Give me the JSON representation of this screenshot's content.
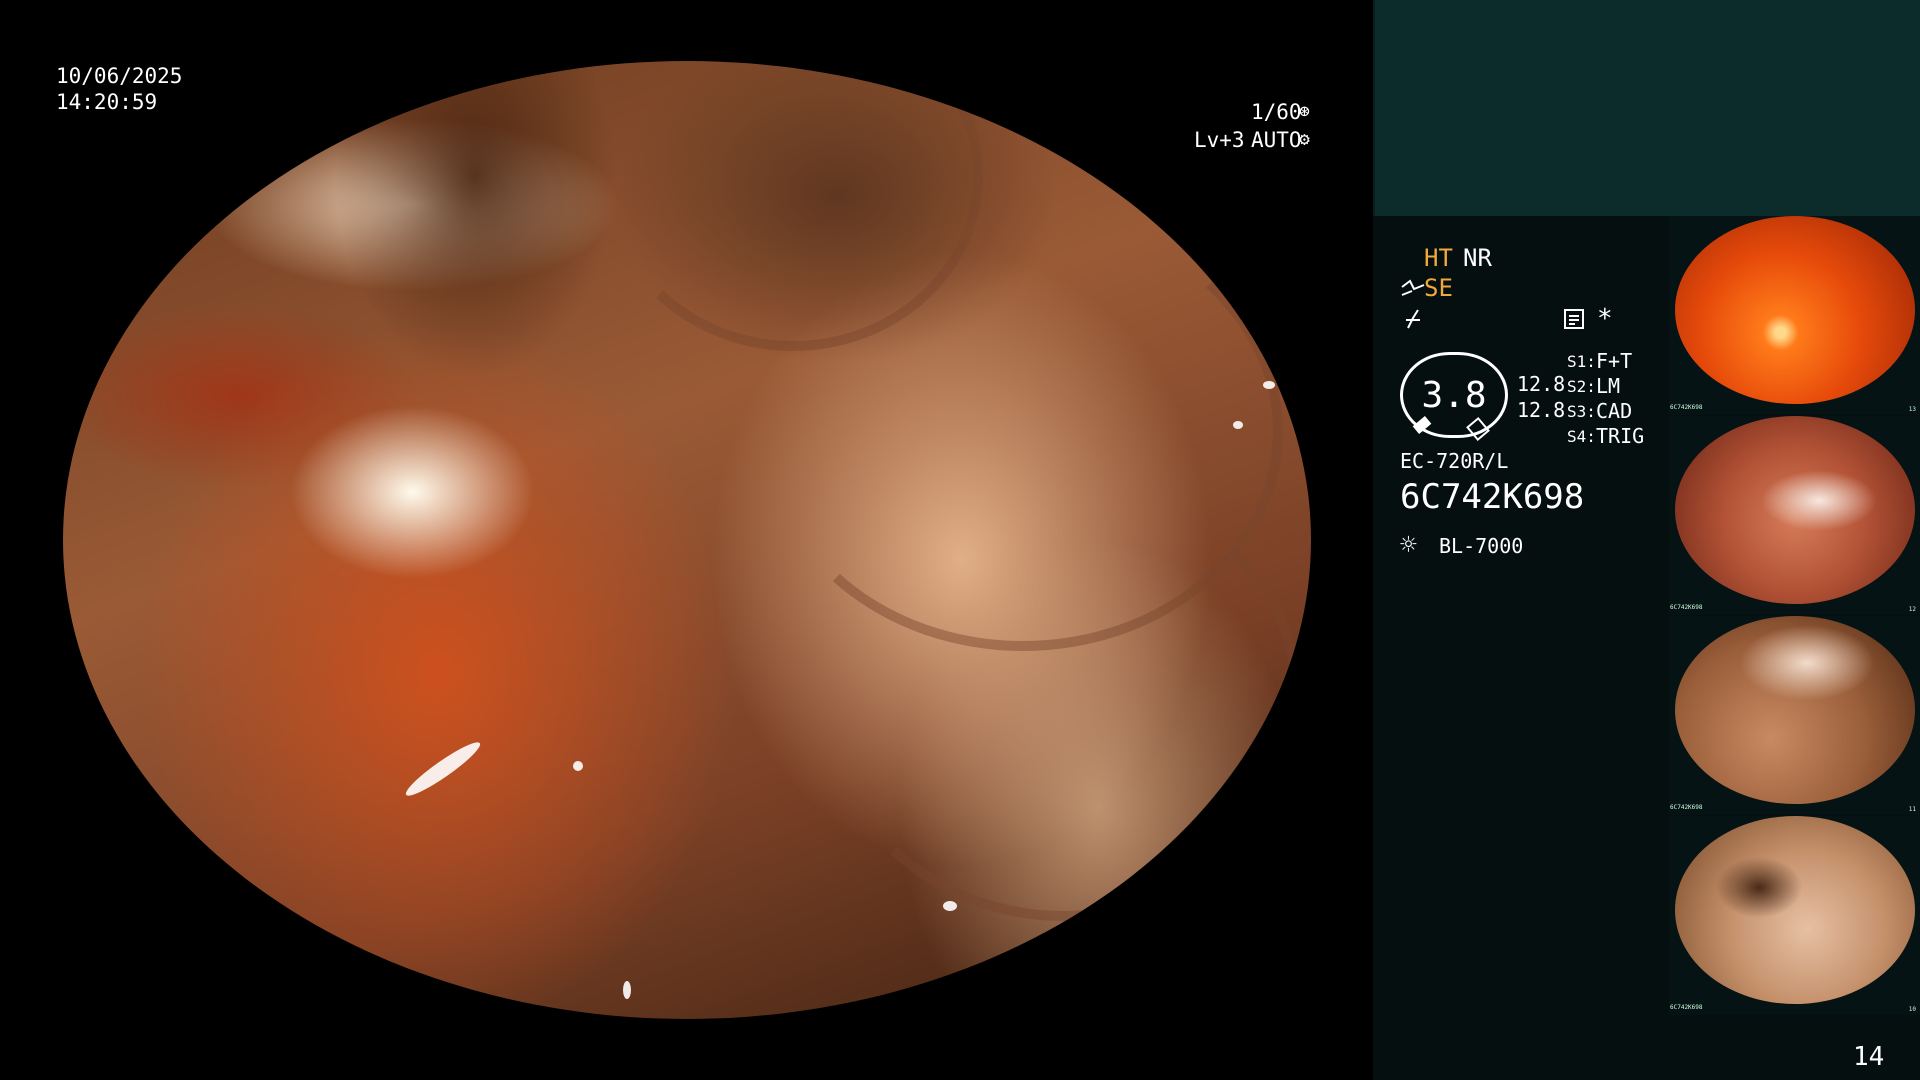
{
  "overlay": {
    "date": "10/06/2025",
    "time": "14:20:59",
    "shutter": "1/60",
    "level": "Lv+3",
    "auto_mode": "AUTO"
  },
  "panel": {
    "ht_label": "HT",
    "nr_label": "NR",
    "se_label": "SE",
    "zoom_value": "3.8",
    "zoom_values": [
      "12.8",
      "12.8"
    ],
    "switches": [
      {
        "key": "S1:",
        "value": "F+T"
      },
      {
        "key": "S2:",
        "value": "LM"
      },
      {
        "key": "S3:",
        "value": "CAD"
      },
      {
        "key": "S4:",
        "value": "TRIG"
      }
    ],
    "scope_model": "EC-720R/L",
    "serial": "6C742K698",
    "light_source": "BL-7000",
    "image_count": "14"
  },
  "thumbnails": [
    {
      "index": "13",
      "serial": "6C742K698"
    },
    {
      "index": "12",
      "serial": "6C742K698"
    },
    {
      "index": "11",
      "serial": "6C742K698"
    },
    {
      "index": "10",
      "serial": "6C742K698"
    }
  ],
  "colors": {
    "accent": "#f2a93b",
    "panel_top": "#0c2b2b",
    "panel_body": "#050f10"
  }
}
